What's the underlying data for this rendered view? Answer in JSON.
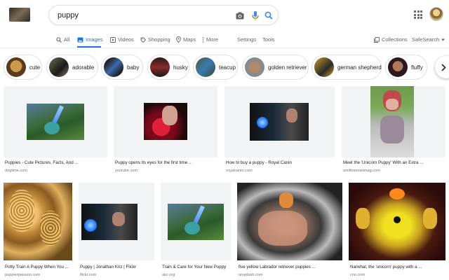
{
  "search": {
    "query": "puppy"
  },
  "tabs": {
    "all": "All",
    "images": "Images",
    "videos": "Videos",
    "shopping": "Shopping",
    "maps": "Maps",
    "more": "More",
    "settings": "Settings",
    "tools": "Tools",
    "collections": "Collections",
    "safesearch": "SafeSearch"
  },
  "chips": [
    {
      "label": "cute",
      "icon": "cute-thumb-icon"
    },
    {
      "label": "adorable",
      "icon": "adorable-thumb-icon"
    },
    {
      "label": "baby",
      "icon": "baby-thumb-icon"
    },
    {
      "label": "husky",
      "icon": "husky-thumb-icon"
    },
    {
      "label": "teacup",
      "icon": "teacup-thumb-icon"
    },
    {
      "label": "golden retriever",
      "icon": "golden-retriever-thumb-icon"
    },
    {
      "label": "german shepherd",
      "icon": "german-shepherd-thumb-icon"
    },
    {
      "label": "fluffy",
      "icon": "fluffy-thumb-icon"
    }
  ],
  "results": [
    {
      "title": "Puppies - Cute Pictures, Facts, And ...",
      "source": "dogtime.com"
    },
    {
      "title": "Puppy opens its eyes for the first time ...",
      "source": "youtube.com"
    },
    {
      "title": "How to buy a puppy - Royal Canin",
      "source": "royalcanin.com"
    },
    {
      "title": "Meet the 'Unicorn Puppy' With an Extra ...",
      "source": "smithsonianmag.com"
    },
    {
      "title": "Potty Train A Puppy When You ...",
      "source": "puppierpassion.com"
    },
    {
      "title": "Puppy | Jonathan Kriz | Flickr",
      "source": "flickr.com"
    },
    {
      "title": "Train & Care for Your New Puppy",
      "source": "akc.org"
    },
    {
      "title": "five yellow Labrador retriever puppies ...",
      "source": "unsplash.com"
    },
    {
      "title": "Narwhal, the 'unicorn' puppy with a ...",
      "source": "cnn.com"
    }
  ],
  "colors": {
    "accent": "#1a73e8",
    "chip_border": "#dfe1e5",
    "tile_bg": "#f1f3f4"
  }
}
